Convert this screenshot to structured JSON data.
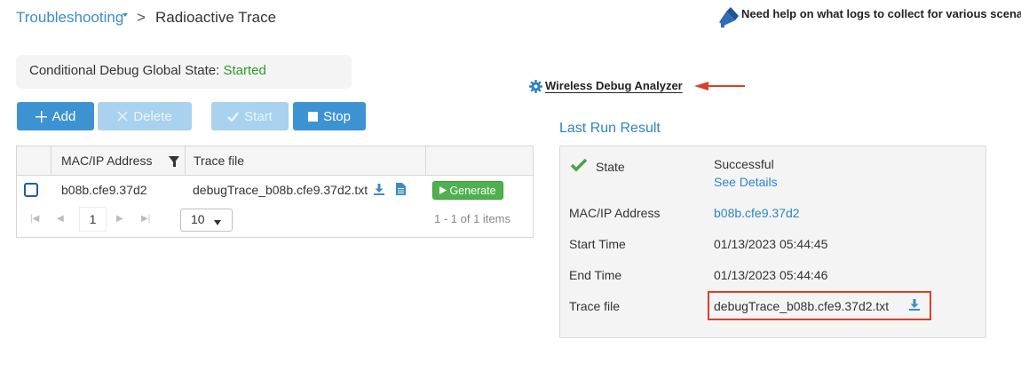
{
  "breadcrumb": {
    "parent": "Troubleshooting",
    "separator": ">",
    "current": "Radioactive Trace"
  },
  "help_link": "Need help on what logs to collect for various scenarios?",
  "global_state": {
    "label": "Conditional Debug Global State:",
    "value": "Started",
    "value_color": "#2a9a2a"
  },
  "toolbar": {
    "add_label": "Add",
    "delete_label": "Delete",
    "start_label": "Start",
    "stop_label": "Stop",
    "accent": "#3d93d2"
  },
  "grid": {
    "columns": [
      "MAC/IP Address",
      "Trace file"
    ],
    "rows": [
      {
        "mac": "b08b.cfe9.37d2",
        "trace_file": "debugTrace_b08b.cfe9.37d2.txt",
        "action_label": "Generate"
      }
    ],
    "pager": {
      "current_page": "1",
      "page_size": "10",
      "summary": "1 - 1 of 1 items"
    }
  },
  "analyzer_link": "Wireless Debug Analyzer",
  "last_run": {
    "title": "Last Run Result",
    "state_label": "State",
    "state_value": "Successful",
    "see_details": "See Details",
    "mac_label": "MAC/IP Address",
    "mac_value": "b08b.cfe9.37d2",
    "start_label": "Start Time",
    "start_value": "01/13/2023 05:44:45",
    "end_label": "End Time",
    "end_value": "01/13/2023 05:44:46",
    "trace_label": "Trace file",
    "trace_value": "debugTrace_b08b.cfe9.37d2.txt"
  },
  "icons": {
    "breadcrumb_caret": "caret-down-icon",
    "help": "megaphone-icon",
    "filter": "filter-icon",
    "download": "download-icon",
    "document": "document-icon",
    "play": "play-icon",
    "gear": "gear-icon",
    "success": "checkmark-icon",
    "annotation": "red-arrow-icon"
  }
}
